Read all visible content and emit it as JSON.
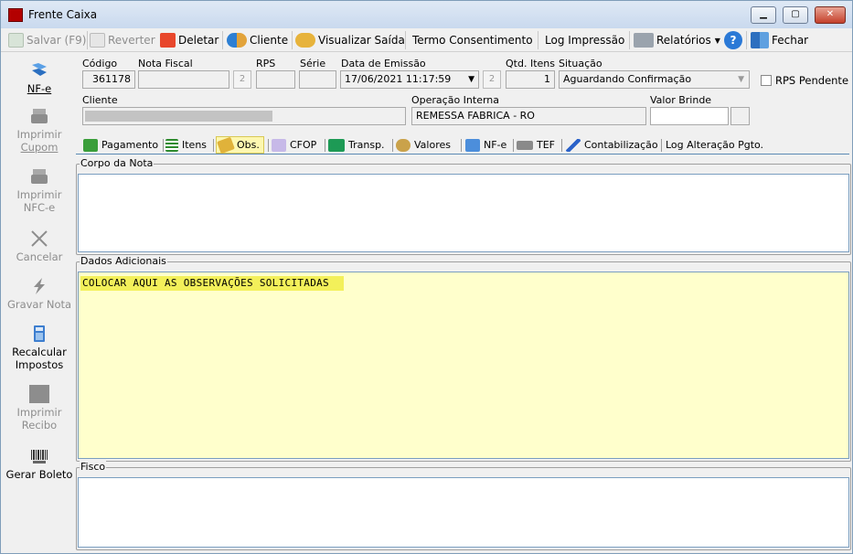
{
  "window": {
    "title": "Frente Caixa"
  },
  "toolbar": {
    "save": "Salvar (F9)",
    "revert": "Reverter",
    "delete": "Deletar",
    "client": "Cliente",
    "view_output": "Visualizar Saída",
    "consent_term": "Termo Consentimento",
    "print_log": "Log Impressão",
    "reports": "Relatórios",
    "close": "Fechar"
  },
  "sidebar": {
    "nfe": "NF-e",
    "print_coupon_1": "Imprimir",
    "print_coupon_2": "Cupom",
    "print_nfce_1": "Imprimir",
    "print_nfce_2": "NFC-e",
    "cancel": "Cancelar",
    "save_note": "Gravar Nota",
    "recalc_1": "Recalcular",
    "recalc_2": "Impostos",
    "print_receipt_1": "Imprimir",
    "print_receipt_2": "Recibo",
    "boleto": "Gerar Boleto"
  },
  "form": {
    "codigo_label": "Código",
    "codigo_value": "361178",
    "nota_fiscal_label": "Nota Fiscal",
    "nota_fiscal_value": "",
    "rps_label": "RPS",
    "rps_value": "",
    "serie_label": "Série",
    "serie_value": "",
    "data_emissao_label": "Data de Emissão",
    "data_emissao_value": "17/06/2021 11:17:59",
    "qtd_itens_label": "Qtd. Itens",
    "qtd_itens_value": "1",
    "situacao_label": "Situação",
    "situacao_value": "Aguardando Confirmação",
    "rps_pendente_label": "RPS Pendente",
    "rps_pendente_checked": false,
    "cliente_label": "Cliente",
    "operacao_label": "Operação Interna",
    "operacao_value": "REMESSA FABRICA - RO",
    "valor_brinde_label": "Valor Brinde",
    "valor_brinde_value": "",
    "refresh_glyph": "2"
  },
  "tabs": [
    {
      "label": "Pagamento"
    },
    {
      "label": "Itens"
    },
    {
      "label": "Obs.",
      "active": true
    },
    {
      "label": "CFOP"
    },
    {
      "label": "Transp."
    },
    {
      "label": "Valores"
    },
    {
      "label": "NF-e"
    },
    {
      "label": "TEF"
    },
    {
      "label": "Contabilização"
    },
    {
      "label": "Log Alteração Pgto."
    }
  ],
  "obs": {
    "corpo_label": "Corpo da Nota",
    "corpo_value": "",
    "dados_label": "Dados Adicionais",
    "dados_value": "COLOCAR AQUI AS OBSERVAÇÕES SOLICITADAS",
    "fisco_label": "Fisco",
    "fisco_value": ""
  },
  "colors": {
    "highlight": "#f3f05a",
    "yellow_area": "#ffffcc",
    "active_tab": "#fdf7b0"
  }
}
